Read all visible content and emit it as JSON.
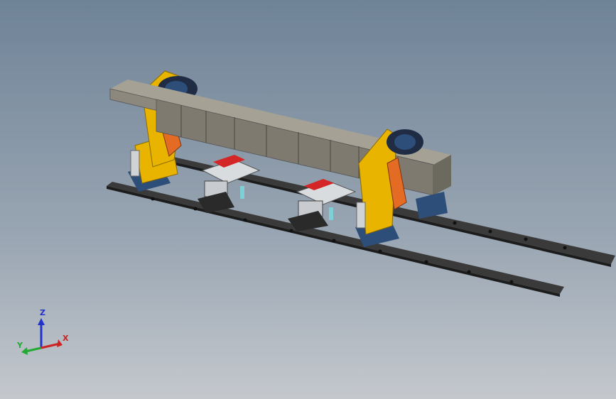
{
  "triad": {
    "z_label": "Z",
    "x_label": "X",
    "y_label": "Y",
    "colors": {
      "z": "#2233cc",
      "x": "#cc2222",
      "y": "#22aa33"
    }
  },
  "colors": {
    "background_top": "#6f8397",
    "beam": "#8c887e",
    "frame_yellow": "#e8b400",
    "bracket_orange": "#e36b24",
    "base_blue": "#2e4e7a",
    "carriage_red": "#d42626",
    "rail_dark": "#2a2a2a"
  }
}
